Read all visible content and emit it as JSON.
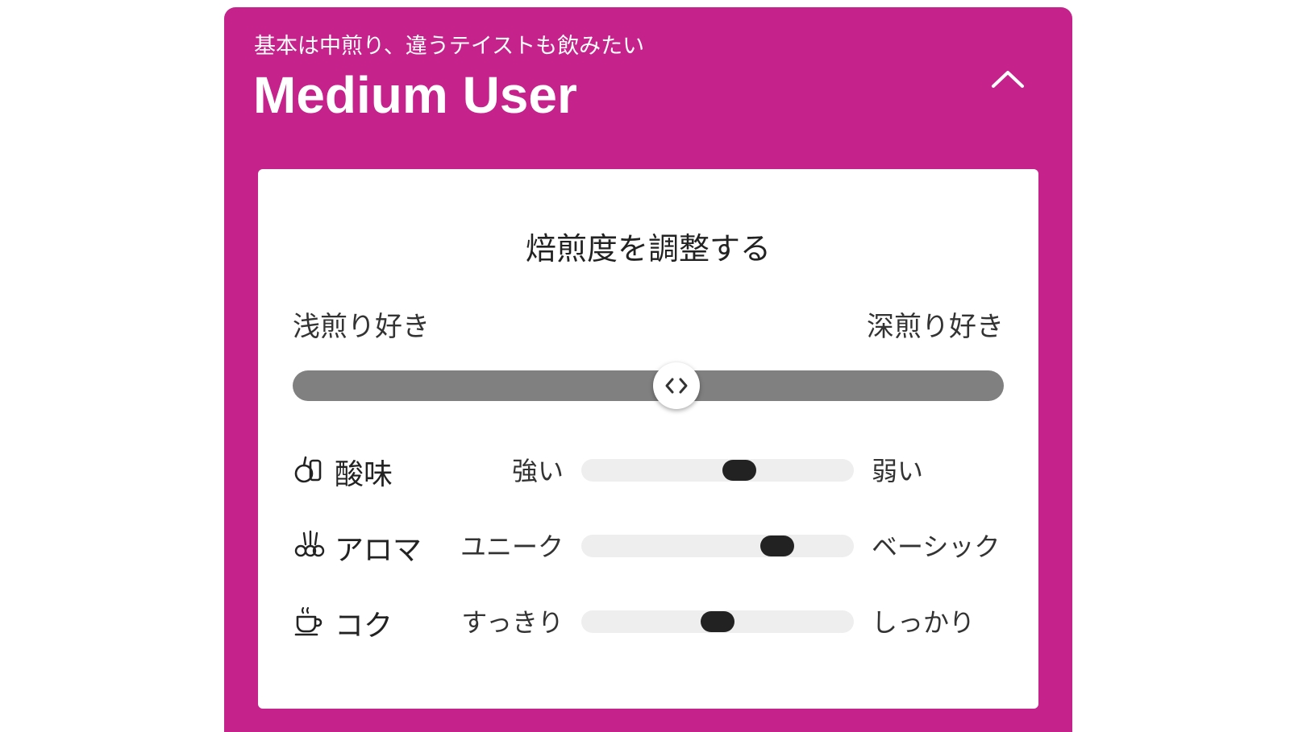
{
  "header": {
    "subtitle": "基本は中煎り、違うテイストも飲みたい",
    "title": "Medium User",
    "collapse_icon": "chevron-up-icon"
  },
  "colors": {
    "card_background": "#c6228c",
    "panel_background": "#ffffff",
    "roast_track": "#808080",
    "attribute_track": "#eeeeee",
    "attribute_thumb": "#222222"
  },
  "roast": {
    "title": "焙煎度を調整する",
    "left_label": "浅煎り好き",
    "right_label": "深煎り好き",
    "value_fraction": 0.54,
    "thumb_icon": "left-right-arrows-icon"
  },
  "attributes": [
    {
      "icon": "lemon-icon",
      "name": "酸味",
      "low_label": "強い",
      "high_label": "弱い",
      "value_fraction": 0.58
    },
    {
      "icon": "flower-icon",
      "name": "アロマ",
      "low_label": "ユニーク",
      "high_label": "ベーシック",
      "value_fraction": 0.72
    },
    {
      "icon": "coffee-cup-icon",
      "name": "コク",
      "low_label": "すっきり",
      "high_label": "しっかり",
      "value_fraction": 0.5
    }
  ]
}
